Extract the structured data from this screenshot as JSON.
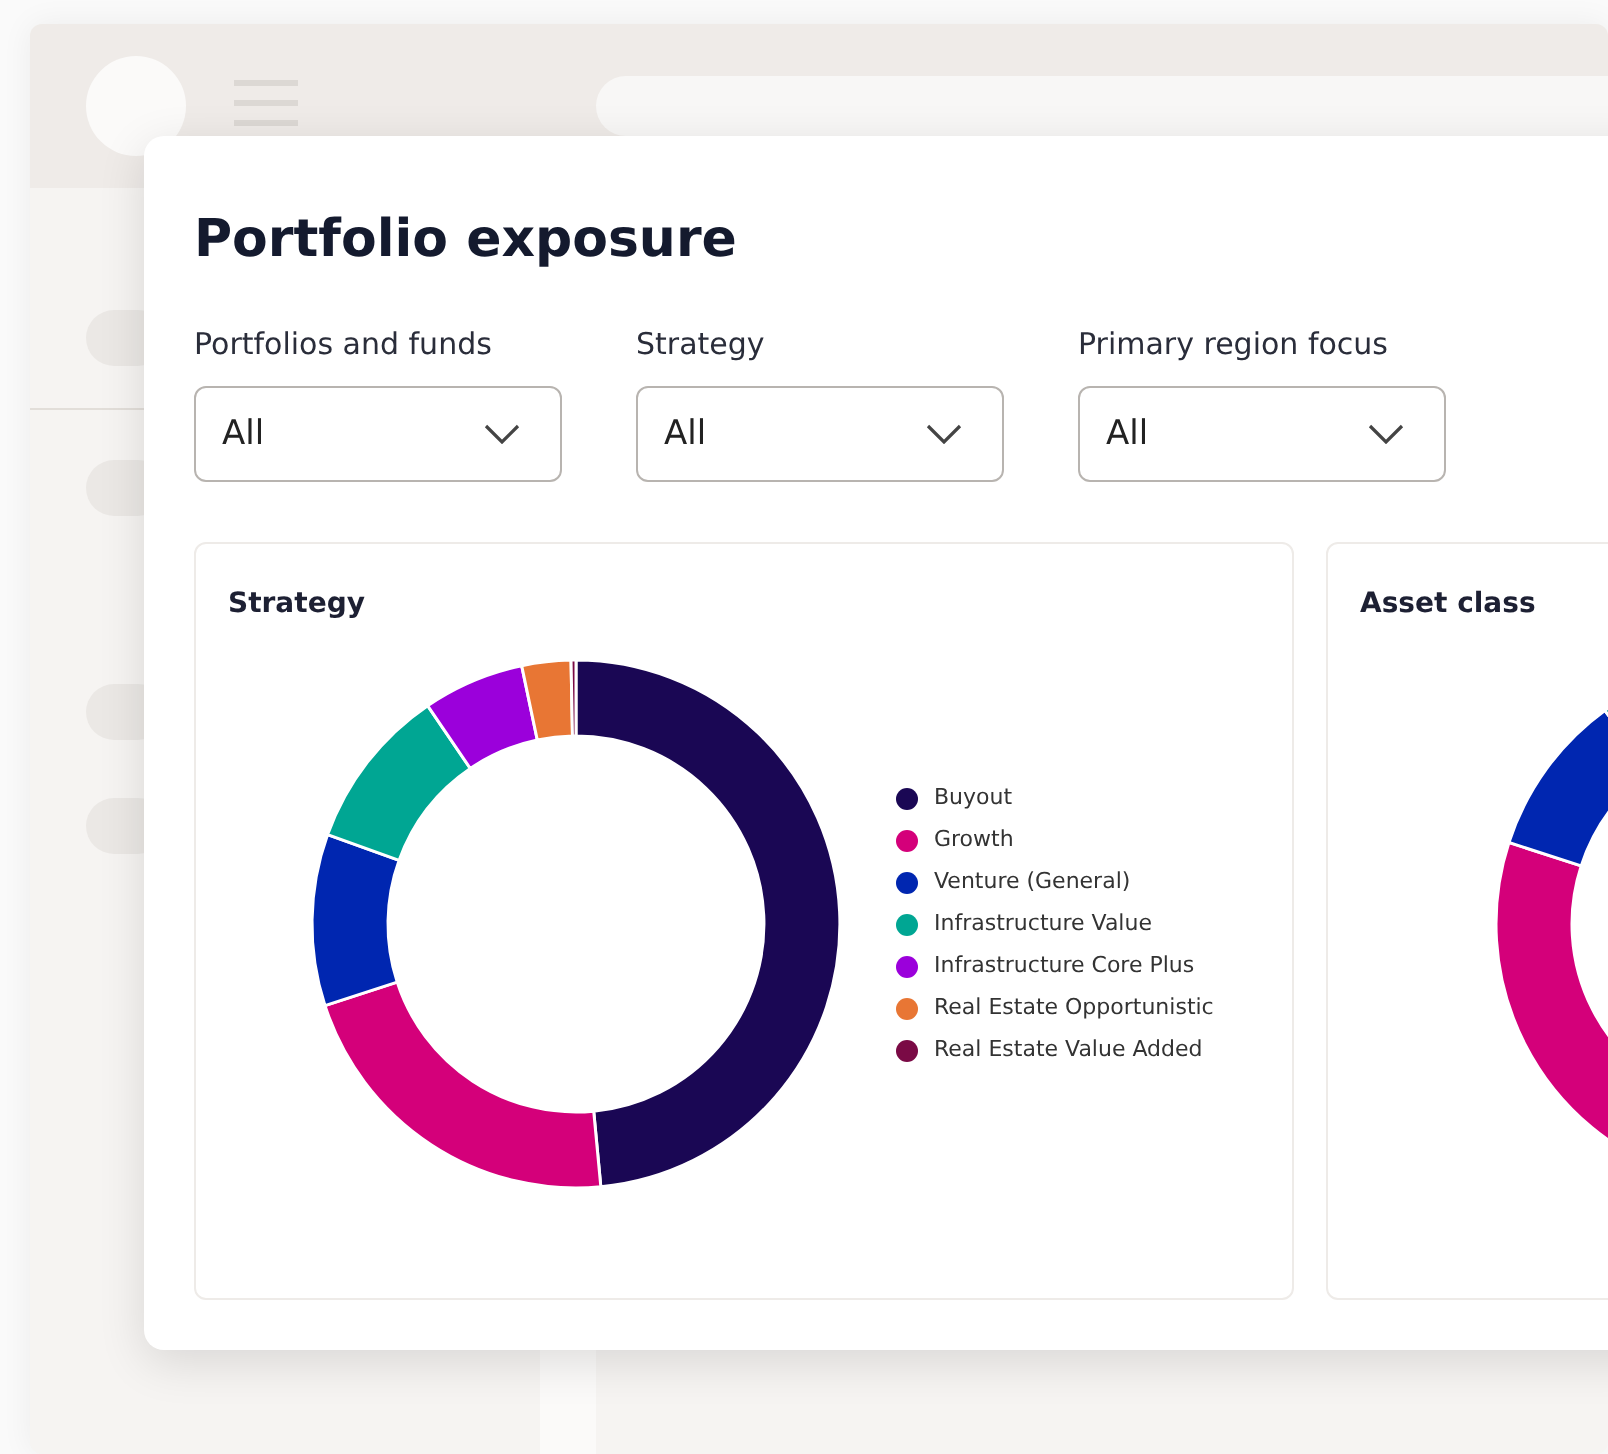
{
  "title": "Portfolio exposure",
  "filters": [
    {
      "label": "Portfolios and funds",
      "value": "All"
    },
    {
      "label": "Strategy",
      "value": "All"
    },
    {
      "label": "Primary region focus",
      "value": "All"
    }
  ],
  "charts": [
    {
      "title": "Strategy",
      "legend": [
        {
          "label": "Buyout",
          "color": "#1a0754"
        },
        {
          "label": "Growth",
          "color": "#d4007a"
        },
        {
          "label": "Venture (General)",
          "color": "#0026b0"
        },
        {
          "label": "Infrastructure Value",
          "color": "#00a693"
        },
        {
          "label": "Infrastructure Core Plus",
          "color": "#9b00db"
        },
        {
          "label": "Real Estate Opportunistic",
          "color": "#e87634"
        },
        {
          "label": "Real Estate Value Added",
          "color": "#7a0a45"
        }
      ]
    },
    {
      "title": "Asset class"
    }
  ]
}
